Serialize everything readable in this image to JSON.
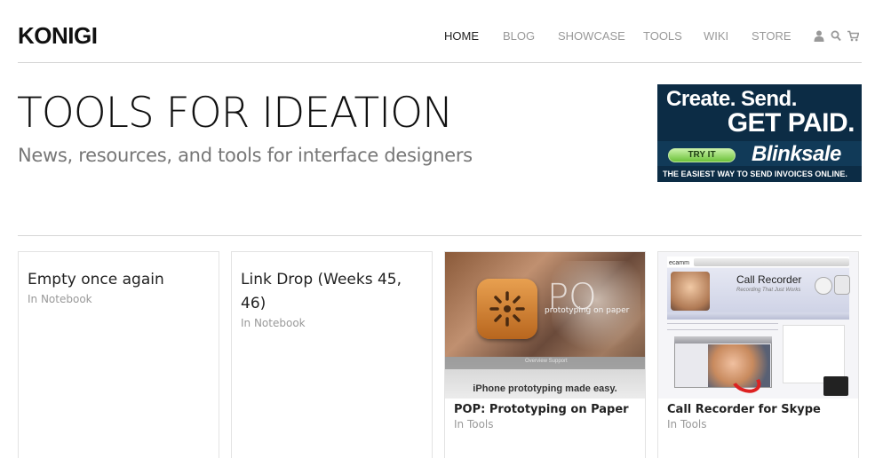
{
  "header": {
    "logo": "KONIGI",
    "nav": [
      {
        "label": "HOME",
        "active": true
      },
      {
        "label": "BLOG",
        "active": false
      },
      {
        "label": "SHOWCASE",
        "active": false
      },
      {
        "label": "TOOLS",
        "active": false
      },
      {
        "label": "WIKI",
        "active": false
      },
      {
        "label": "STORE",
        "active": false
      }
    ],
    "icons": [
      "user-icon",
      "search-icon",
      "cart-icon"
    ]
  },
  "hero": {
    "title": "TOOLS FOR IDEATION",
    "subtitle": "News, resources, and tools for interface designers"
  },
  "ad": {
    "line1": "Create. Send.",
    "line2": "GET PAID.",
    "button": "TRY IT",
    "brand": "Blinksale",
    "tagline": "THE EASIEST WAY TO SEND INVOICES ONLINE."
  },
  "cards": [
    {
      "title": "Empty once again",
      "category": "In Notebook"
    },
    {
      "title": "Link Drop (Weeks 45, 46)",
      "category": "In Notebook"
    },
    {
      "title": "POP: Prototyping on Paper",
      "category": "In Tools",
      "thumb": {
        "big_text": "PO",
        "sub": "prototyping on paper",
        "caption": "iPhone prototyping made easy.",
        "links": "Overview    Support"
      }
    },
    {
      "title": "Call Recorder for Skype",
      "category": "In Tools",
      "thumb": {
        "logo": "ecamm",
        "title": "Call Recorder",
        "tag": "Recording That Just Works"
      }
    }
  ],
  "colors": {
    "nav_active": "#222222",
    "nav_inactive": "#999999",
    "ad_background": "#0c2c45",
    "ad_button": "#6cc23a",
    "rule": "#d6d6d6"
  }
}
